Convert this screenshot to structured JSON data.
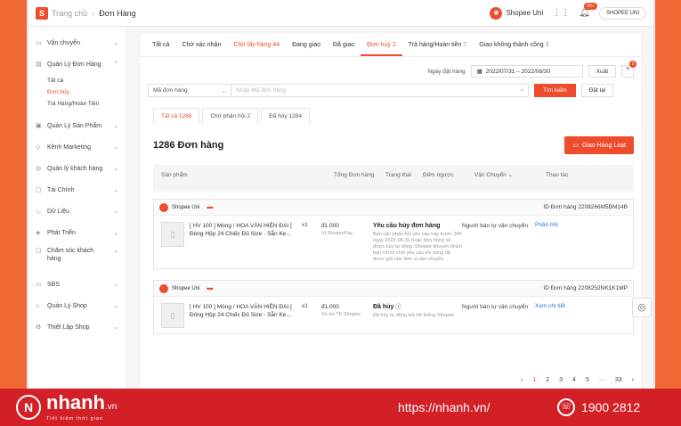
{
  "topbar": {
    "breadcrumb_home": "Trang chủ",
    "breadcrumb_sep": "›",
    "breadcrumb_current": "Đơn Hàng",
    "shop_name": "Shopee Uni",
    "notif_badge": "99+",
    "shop_button": "SHOPEE UNI"
  },
  "sidebar": {
    "items": [
      {
        "label": "Vận chuyển",
        "icon": "truck-icon"
      },
      {
        "label": "Quản Lý Đơn Hàng",
        "icon": "clipboard-icon"
      },
      {
        "label": "Quản Lý Sản Phẩm",
        "icon": "box-icon"
      },
      {
        "label": "Kênh Marketing",
        "icon": "tag-icon"
      },
      {
        "label": "Quản lý khách hàng",
        "icon": "user-icon"
      },
      {
        "label": "Tài Chính",
        "icon": "wallet-icon"
      },
      {
        "label": "Dữ Liệu",
        "icon": "chart-icon"
      },
      {
        "label": "Phát Triển",
        "icon": "growth-icon"
      },
      {
        "label": "Chăm sóc khách hàng",
        "icon": "support-icon"
      },
      {
        "label": "SBS",
        "icon": "warehouse-icon"
      },
      {
        "label": "Quản Lý Shop",
        "icon": "shop-icon"
      },
      {
        "label": "Thiết Lập Shop",
        "icon": "settings-icon"
      }
    ],
    "sub_items": [
      "Tất cả",
      "Đơn hủy",
      "Trả Hàng/Hoàn Tiền"
    ]
  },
  "tabs": [
    {
      "label": "Tất cả",
      "count": ""
    },
    {
      "label": "Chờ xác nhận",
      "count": ""
    },
    {
      "label": "Chờ lấy hàng",
      "count": "44"
    },
    {
      "label": "Đang giao",
      "count": ""
    },
    {
      "label": "Đã giao",
      "count": ""
    },
    {
      "label": "Đơn huỷ",
      "count": "2"
    },
    {
      "label": "Trả hàng/Hoàn tiền",
      "count": "7"
    },
    {
      "label": "Giao không thành công",
      "count": "3"
    }
  ],
  "filter": {
    "date_label": "Ngày đặt hàng",
    "date_range": "2022/07/31 – 2022/08/30",
    "export": "Xuất",
    "menu_badge": "2"
  },
  "search": {
    "select_value": "Mã đơn hàng",
    "placeholder": "Nhập Mã đơn hàng",
    "search_btn": "Tìm kiếm",
    "reset_btn": "Đặt lại"
  },
  "subtabs": [
    "Tất cả 1286",
    "Chờ phản hồi 2",
    "Đã hủy 1284"
  ],
  "count_title": "1286 Đơn hàng",
  "bulk_btn": "Giao Hàng Loạt",
  "table_head": {
    "product": "Sản phẩm",
    "total": "Tổng Đơn hàng",
    "status": "Trạng thái",
    "countdown": "Đếm ngược",
    "shipping": "Vận Chuyển",
    "action": "Thao tác"
  },
  "orders": [
    {
      "shop": "Shopee Uni",
      "id": "ID Đơn hàng 2208266M5BM14B",
      "name": "[ HV 100 ] Móng / HOA VĂN HIỆN ĐẠI [ Đóng Hộp 24 Chiếc Đủ Size - Sẵn Ke...",
      "qty": "x1",
      "price": "đ1.000",
      "pay": "Ví ShopeePay",
      "status": "Yêu cầu hủy đơn hàng",
      "note": "Bạn cần phản hồi yêu cầu này trước 24h ngày 2022-08-30 hoặc đơn hàng sẽ được hủy tự động. Shopee khuyến khích bạn chỉ từ chối yêu cầu khi hàng đã được gửi cho đơn vị vận chuyển.",
      "ship": "Người bán tự vận chuyển",
      "action": "Phản hồi"
    },
    {
      "shop": "Shopee Uni",
      "id": "ID Đơn hàng 2208252NK1K1MP",
      "name": "[ HV 100 ] Móng / HOA VĂN HIỆN ĐẠI [ Đóng Hộp 24 Chiếc Đủ Size - Sẵn Ke...",
      "qty": "x1",
      "price": "đ1.000",
      "pay": "Số dư TK Shopee",
      "status": "Đã hủy",
      "note": "Đã hủy tự động bởi hệ thống Shopee",
      "ship": "Người bán tự vận chuyển",
      "action": "Xem chi tiết"
    }
  ],
  "pager": [
    "‹",
    "1",
    "2",
    "3",
    "4",
    "5",
    "···",
    "33",
    "›"
  ],
  "footer": {
    "brand": "nhanh",
    "brand_suffix": ".vn",
    "slogan": "Tiết kiệm thời gian",
    "url": "https://nhanh.vn/",
    "phone": "1900 2812"
  },
  "colors": {
    "accent": "#ee4d2d",
    "footer": "#d31f26",
    "link": "#2673dd",
    "background": "#f06a33"
  }
}
